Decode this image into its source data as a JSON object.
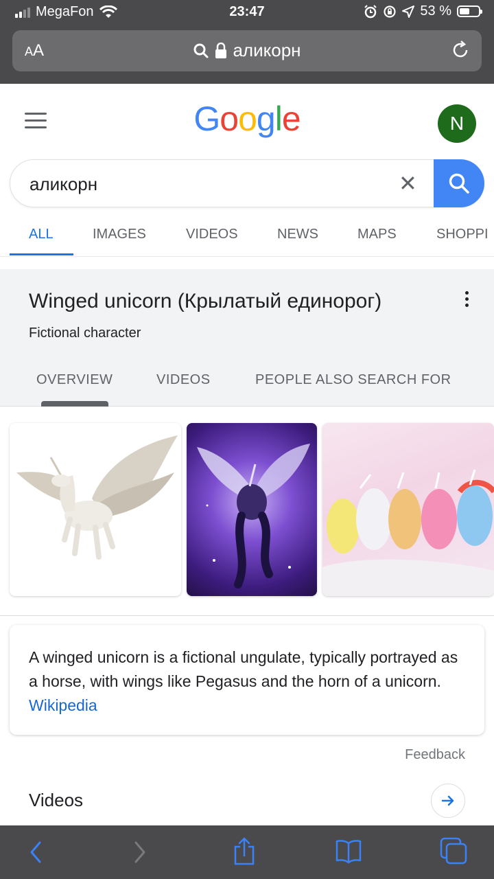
{
  "status_bar": {
    "carrier": "MegaFon",
    "time": "23:47",
    "battery_percent": "53 %",
    "battery_level": 0.53
  },
  "url_bar": {
    "text_size_label": "AA",
    "address": "аликорн"
  },
  "header": {
    "logo_text": "Google",
    "logo_colors": [
      "#4285F4",
      "#EA4335",
      "#FBBC05",
      "#4285F4",
      "#34A853",
      "#EA4335"
    ],
    "avatar_initial": "N"
  },
  "search": {
    "query": "аликорн"
  },
  "tabs": [
    {
      "label": "ALL",
      "active": true
    },
    {
      "label": "IMAGES"
    },
    {
      "label": "VIDEOS"
    },
    {
      "label": "NEWS"
    },
    {
      "label": "MAPS"
    },
    {
      "label": "SHOPPI"
    }
  ],
  "knowledge_panel": {
    "title": "Winged unicorn (Крылатый единорог)",
    "subtitle": "Fictional character",
    "tabs": [
      "OVERVIEW",
      "VIDEOS",
      "PEOPLE ALSO SEARCH FOR"
    ]
  },
  "description": {
    "text": "A winged unicorn is a fictional ungulate, typically portrayed as a horse, with wings like Pegasus and the horn of a unicorn.",
    "source_link": "Wikipedia"
  },
  "feedback_label": "Feedback",
  "videos_heading": "Videos",
  "accent_color": "#1a73e8"
}
